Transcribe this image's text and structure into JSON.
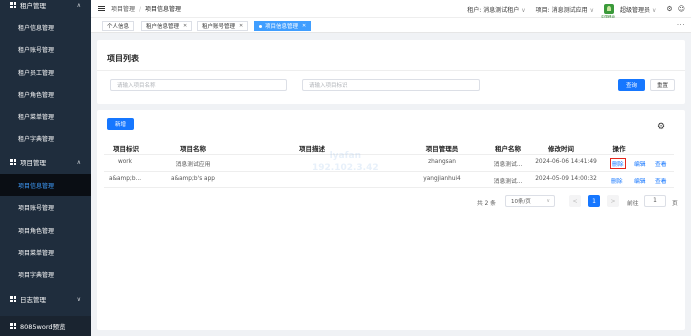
{
  "sidebar": {
    "top_group": {
      "label": "租户管理",
      "icon": "grid-icon",
      "chevron": "∧"
    },
    "tenant_items": [
      {
        "label": "租户信息管理"
      },
      {
        "label": "租户账号管理"
      },
      {
        "label": "租户员工管理"
      },
      {
        "label": "租户角色管理"
      },
      {
        "label": "租户菜单管理"
      },
      {
        "label": "租户字典管理"
      }
    ],
    "project_group": {
      "label": "项目管理",
      "icon": "grid-icon",
      "chevron": "∧"
    },
    "project_items": [
      {
        "label": "项目信息管理",
        "active": true
      },
      {
        "label": "项目账号管理"
      },
      {
        "label": "项目角色管理"
      },
      {
        "label": "项目菜单管理"
      },
      {
        "label": "项目字典管理"
      }
    ],
    "log_group": {
      "label": "日志管理",
      "icon": "grid-icon",
      "chevron": "∨"
    },
    "bottom_item": {
      "label": "8085word预览",
      "icon": "grid-icon"
    },
    "colors": {
      "bg": "#1f2d3d",
      "active_text": "#409eff"
    }
  },
  "topbar": {
    "menu_icon": "hamburger-icon",
    "breadcrumb": [
      "项目管理",
      "项目信息管理"
    ],
    "tenant_label": "租户:",
    "tenant_value": "消息测试租户",
    "project_label": "项目:",
    "project_value": "消息测试应用",
    "logo_caption": "中国移动",
    "user_name": "超级管理员",
    "dropdown_icon": "chevron-down-icon",
    "settings_icon": "gear-icon",
    "user_icon": "user-icon"
  },
  "tags": [
    {
      "label": "个人信息",
      "closable": false,
      "active": false
    },
    {
      "label": "租户信息管理",
      "closable": true,
      "active": false
    },
    {
      "label": "租户账号管理",
      "closable": true,
      "active": false
    },
    {
      "label": "项目信息管理",
      "closable": true,
      "active": true
    }
  ],
  "tags_more": "···",
  "filter": {
    "title": "项目列表",
    "name_placeholder": "请输入项目名称",
    "id_placeholder": "请输入项目标识",
    "search_label": "查询",
    "reset_label": "重置"
  },
  "table": {
    "add_label": "新增",
    "columns": [
      "项目标识",
      "项目名称",
      "项目描述",
      "项目管理员",
      "租户名称",
      "修改时间",
      "操作"
    ],
    "rows": [
      {
        "id": "work",
        "name": "消息测试应用",
        "desc": "",
        "admin": "zhangsan",
        "tenant": "消息测试...",
        "modified": "2024-06-06 14:41:49",
        "ops": [
          "删除",
          "编辑",
          "查看"
        ]
      },
      {
        "id": "a&amp;b...",
        "name": "a&amp;b's app",
        "desc": "",
        "admin": "yangjianhui4",
        "tenant": "消息测试...",
        "modified": "2024-05-09 14:00:32",
        "ops": [
          "删除",
          "编辑",
          "查看"
        ]
      }
    ],
    "watermark": [
      "lyafan",
      "192.102.3.42"
    ],
    "accent": "#1677ff",
    "highlight": "#e5261b"
  },
  "pagination": {
    "total_text": "共 2 条",
    "page_size": "10条/页",
    "prev": "<",
    "current": "1",
    "next": ">",
    "goto_label": "前往",
    "goto_value": "1",
    "page_suffix": "页"
  }
}
